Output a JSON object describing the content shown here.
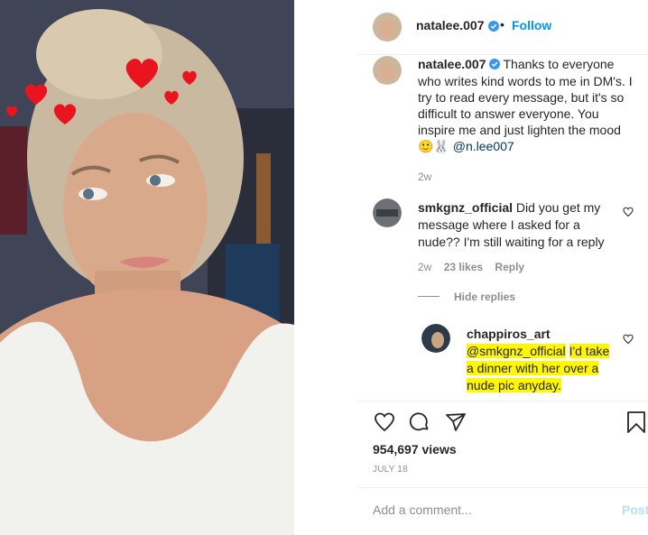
{
  "post": {
    "username": "natalee.007",
    "follow_label": "Follow",
    "separator": "•",
    "caption_username": "natalee.007",
    "caption_text": "Thanks to everyone who writes kind words to me in DM's. I try to read every message, but it's so difficult to answer everyone. You inspire me and just lighten the mood 🙂🐰",
    "caption_mention": "@n.lee007",
    "caption_age": "2w"
  },
  "comments": [
    {
      "username": "smkgnz_official",
      "text": "Did you get my message where I asked for a nude?? I'm still waiting for a reply",
      "age": "2w",
      "likes": "23 likes",
      "reply_label": "Reply",
      "hide_replies_label": "Hide replies"
    }
  ],
  "reply": {
    "username": "chappiros_art",
    "mention": "@smkgnz_official",
    "text": "I'd take a dinner with her over a nude pic anyday."
  },
  "stats": {
    "views": "954,697 views",
    "date": "JULY 18"
  },
  "comment_box": {
    "placeholder": "Add a comment...",
    "post_label": "Post"
  },
  "colors": {
    "accent": "#0095f6",
    "highlight": "#fff700",
    "heart_red": "#e8151f"
  },
  "icons": [
    "verified-icon",
    "heart-icon",
    "comment-icon",
    "share-icon",
    "bookmark-icon"
  ]
}
